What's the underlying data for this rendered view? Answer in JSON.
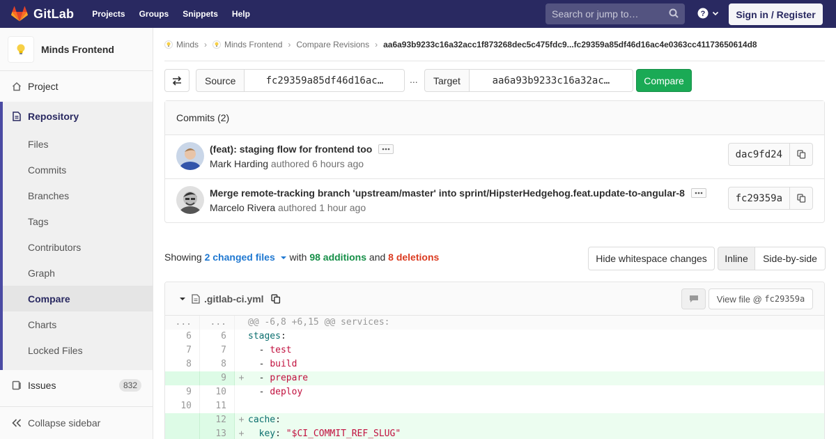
{
  "nav": {
    "brand": "GitLab",
    "links": [
      "Projects",
      "Groups",
      "Snippets",
      "Help"
    ],
    "search_placeholder": "Search or jump to…",
    "signin": "Sign in / Register"
  },
  "sidebar": {
    "project_name": "Minds Frontend",
    "project": "Project",
    "repository": "Repository",
    "repo_items": [
      "Files",
      "Commits",
      "Branches",
      "Tags",
      "Contributors",
      "Graph",
      "Compare",
      "Charts",
      "Locked Files"
    ],
    "issues": "Issues",
    "issues_count": "832",
    "collapse": "Collapse sidebar"
  },
  "breadcrumb": {
    "items": [
      "Minds",
      "Minds Frontend",
      "Compare Revisions"
    ],
    "current": "aa6a93b9233c16a32acc1f873268dec5c475fdc9...fc29359a85df46d16ac4e0363cc41173650614d8"
  },
  "compare": {
    "source_label": "Source",
    "source_value": "fc29359a85df46d16ac…",
    "separator": "...",
    "target_label": "Target",
    "target_value": "aa6a93b9233c16a32ac…",
    "button": "Compare"
  },
  "commits": {
    "header": "Commits (2)",
    "items": [
      {
        "title": "(feat): staging flow for frontend too",
        "author": "Mark Harding",
        "meta": "authored 6 hours ago",
        "sha": "dac9fd24"
      },
      {
        "title": "Merge remote-tracking branch 'upstream/master' into sprint/HipsterHedgehog.feat.update-to-angular-8",
        "author": "Marcelo Rivera",
        "meta": "authored 1 hour ago",
        "sha": "fc29359a"
      }
    ]
  },
  "summary": {
    "showing": "Showing",
    "changed": "2 changed files",
    "with": "with",
    "additions": "98 additions",
    "and": "and",
    "deletions": "8 deletions",
    "whitespace": "Hide whitespace changes",
    "inline": "Inline",
    "side_by_side": "Side-by-side"
  },
  "diff": {
    "filename": ".gitlab-ci.yml",
    "view_file_prefix": "View file @",
    "view_file_sha": "fc29359a",
    "lines": [
      {
        "type": "match",
        "old": "...",
        "new": "...",
        "sign": "",
        "code": "@@ -6,8 +6,15 @@ services:"
      },
      {
        "type": "ctx",
        "old": "6",
        "new": "6",
        "sign": "",
        "code": "stages:"
      },
      {
        "type": "ctx",
        "old": "7",
        "new": "7",
        "sign": "",
        "code": "  - test"
      },
      {
        "type": "ctx",
        "old": "8",
        "new": "8",
        "sign": "",
        "code": "  - build"
      },
      {
        "type": "add",
        "old": "",
        "new": "9",
        "sign": "+",
        "code": "  - prepare"
      },
      {
        "type": "ctx",
        "old": "9",
        "new": "10",
        "sign": "",
        "code": "  - deploy"
      },
      {
        "type": "ctx",
        "old": "10",
        "new": "11",
        "sign": "",
        "code": ""
      },
      {
        "type": "add",
        "old": "",
        "new": "12",
        "sign": "+",
        "code": "cache:"
      },
      {
        "type": "add",
        "old": "",
        "new": "13",
        "sign": "+",
        "code": "  key: \"$CI_COMMIT_REF_SLUG\""
      }
    ]
  },
  "colors": {
    "nav_bg": "#292961",
    "accent": "#4b4ba3",
    "compare_green": "#1aaa55",
    "link_blue": "#1f78d1",
    "add_green": "#168f48",
    "delete_red": "#db3b21"
  }
}
